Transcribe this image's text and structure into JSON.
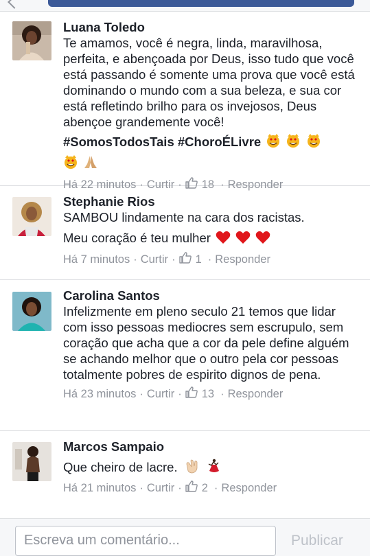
{
  "comments": [
    {
      "name": "Luana Toledo",
      "text_lines": [
        "Te amamos, você é negra, linda, maravilhosa, perfeita, e abençoada por Deus, isso tudo que você está passando é somente uma prova que você está dominando o mundo com a sua beleza, e sua cor está refletindo brilho para os invejosos, Deus abençoe grandemente você!"
      ],
      "hashtags": "#SomosTodosTais #ChoroÉLivre",
      "time": "Há 22 minutos",
      "reply_action": "Curtir",
      "likes": "18",
      "respond_action": "Responder"
    },
    {
      "name": "Stephanie Rios",
      "text_lines": [
        "SAMBOU lindamente na cara dos racistas.",
        "Meu coração é teu mulher"
      ],
      "time": "Há 7 minutos",
      "reply_action": "Curtir",
      "likes": "1",
      "respond_action": "Responder"
    },
    {
      "name": "Carolina Santos",
      "text_lines": [
        "Infelizmente em pleno seculo 21 temos que lidar com isso pessoas mediocres sem escrupulo, sem coração que acha que a cor da pele define alguém se achando melhor que o outro pela cor pessoas totalmente pobres de espirito dignos de pena."
      ],
      "time": "Há 23 minutos",
      "reply_action": "Curtir",
      "likes": "13",
      "respond_action": "Responder"
    },
    {
      "name": "Marcos Sampaio",
      "text_lines": [
        "Que cheiro de lacre."
      ],
      "time": "Há 21 minutos",
      "reply_action": "Curtir",
      "likes": "2",
      "respond_action": "Responder"
    }
  ],
  "composer": {
    "placeholder": "Escreva um comentário...",
    "publish_label": "Publicar"
  },
  "colors": {
    "link_blue": "#3b5998",
    "meta_gray": "#90949c",
    "heart_red": "#e0161b"
  },
  "icons": [
    "back-icon",
    "like-icon",
    "smiling-cat-heart-eyes-icon",
    "praying-hands-icon",
    "red-heart-icon",
    "clapping-hands-icon",
    "dancer-icon"
  ]
}
